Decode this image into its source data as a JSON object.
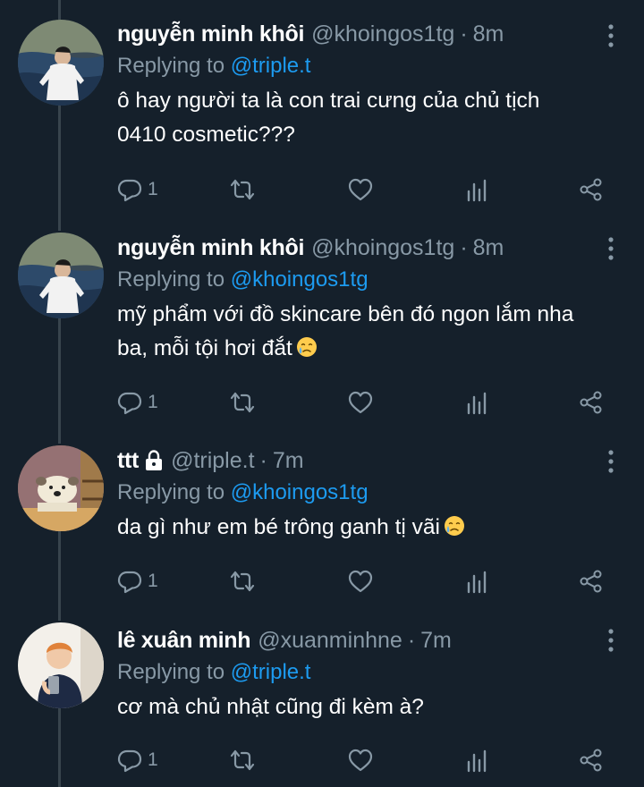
{
  "colors": {
    "background": "#15202b",
    "text": "#ffffff",
    "secondary": "#8899a6",
    "link": "#1d9bf0",
    "thread_line": "#38444d"
  },
  "tweets": [
    {
      "name": "nguyễn minh khôi",
      "handle": "@khoingos1tg",
      "dot": "·",
      "time": "8m",
      "replying_prefix": "Replying to",
      "replying_to": "@triple.t",
      "text": "ô hay người ta là con trai cưng của chủ tịch 0410 cosmetic???",
      "reply_count": "1",
      "locked": false,
      "emoji": null
    },
    {
      "name": "nguyễn minh khôi",
      "handle": "@khoingos1tg",
      "dot": "·",
      "time": "8m",
      "replying_prefix": "Replying to",
      "replying_to": "@khoingos1tg",
      "text": "mỹ phẩm với đồ skincare bên đó ngon lắm nha ba, mỗi tội hơi đắt",
      "reply_count": "1",
      "locked": false,
      "emoji": "crying-face"
    },
    {
      "name": "ttt",
      "handle": "@triple.t",
      "dot": "·",
      "time": "7m",
      "replying_prefix": "Replying to",
      "replying_to": "@khoingos1tg",
      "text": "da gì như em bé trông ganh tị vãi",
      "reply_count": "1",
      "locked": true,
      "emoji": "crying-face"
    },
    {
      "name": "lê xuân minh",
      "handle": "@xuanminhne",
      "dot": "·",
      "time": "7m",
      "replying_prefix": "Replying to",
      "replying_to": "@triple.t",
      "text": "cơ mà chủ nhật cũng đi kèm à?",
      "reply_count": "1",
      "locked": false,
      "emoji": null
    }
  ],
  "icons": {
    "reply": "reply-icon",
    "retweet": "retweet-icon",
    "like": "heart-icon",
    "views": "analytics-icon",
    "share": "share-icon",
    "more": "more-vertical-icon",
    "lock": "lock-icon"
  }
}
